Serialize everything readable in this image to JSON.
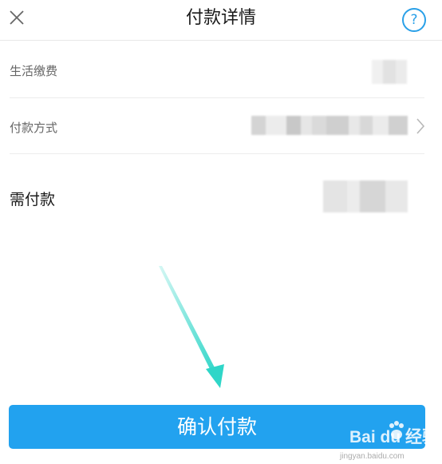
{
  "header": {
    "title": "付款详情",
    "close_icon": "close-icon",
    "help_icon": "help-icon",
    "help_glyph": "?"
  },
  "rows": {
    "service_label": "生活缴费",
    "payment_method_label": "付款方式",
    "amount_label": "需付款"
  },
  "confirm_button": {
    "label": "确认付款",
    "color": "#22a2ef"
  },
  "annotation": {
    "arrow_color": "#2fd6c8"
  },
  "watermark": {
    "brand": "Bai du 经验",
    "url": "jingyan.baidu.com"
  }
}
